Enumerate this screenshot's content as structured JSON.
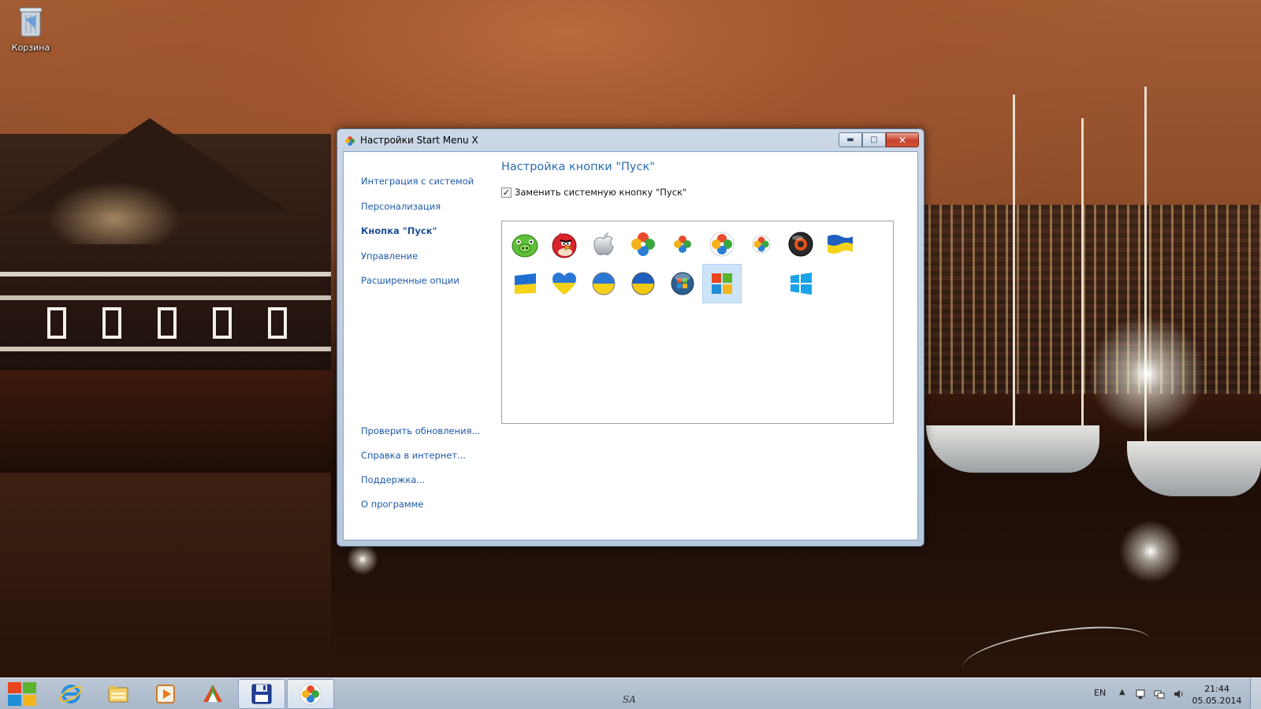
{
  "desktop": {
    "recycle_bin_label": "Корзина"
  },
  "window": {
    "title": "Настройки Start Menu X",
    "minimize_icon": "minimize-icon",
    "maximize_icon": "maximize-icon",
    "close_icon": "close-icon"
  },
  "nav": {
    "items": [
      {
        "label": "Интеграция с системой",
        "active": false
      },
      {
        "label": "Персонализация",
        "active": false
      },
      {
        "label": "Кнопка \"Пуск\"",
        "active": true
      },
      {
        "label": "Управление",
        "active": false
      },
      {
        "label": "Расширенные опции",
        "active": false
      }
    ],
    "bottom_items": [
      {
        "label": "Проверить обновления..."
      },
      {
        "label": "Справка в интернет..."
      },
      {
        "label": "Поддержка..."
      },
      {
        "label": "О программе"
      }
    ]
  },
  "main": {
    "section_title": "Настройка кнопки \"Пуск\"",
    "replace_checkbox_label": "Заменить системную кнопку \"Пуск\"",
    "replace_checked": true,
    "icons_row1": [
      "green-pig-icon",
      "red-angry-bird-icon",
      "apple-logo-icon",
      "colored-clover-icon",
      "small-clover-icon",
      "clover-ring-icon",
      "small-clover-ring-icon",
      "dark-orb-icon",
      "ukraine-flag-wave-icon"
    ],
    "icons_row2": [
      "ukraine-flag-icon",
      "ukraine-heart-icon",
      "ukraine-orb-icon",
      "ukraine-orb-small-icon",
      "windows7-orb-icon",
      "windows-flag-icon",
      "blank-icon",
      "windows8-logo-icon"
    ],
    "selected_icon": "windows-flag-icon"
  },
  "taskbar": {
    "center_text": "SA",
    "language": "EN",
    "time": "21:44",
    "date": "05.05.2014",
    "apps": [
      "internet-explorer-icon",
      "file-explorer-icon",
      "media-player-icon",
      "start-menu-x-icon",
      "floppy-save-icon",
      "clover-app-icon"
    ]
  },
  "colors": {
    "accent": "#2b6cb0",
    "link": "#1e5aa8",
    "selection": "#cce4f7"
  }
}
